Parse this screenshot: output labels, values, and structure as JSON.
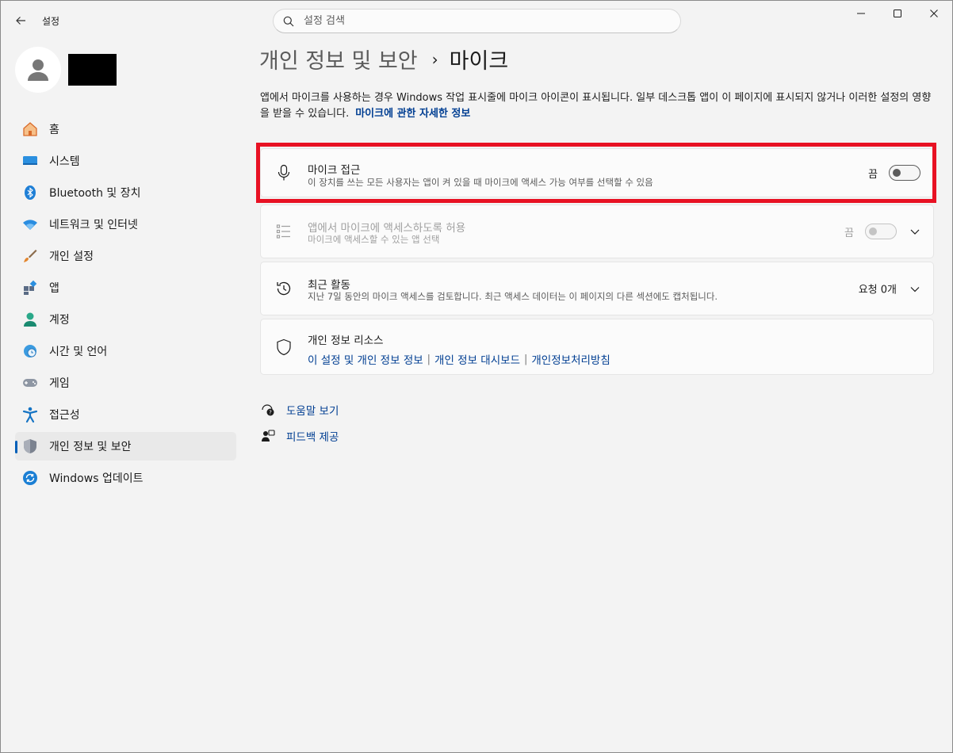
{
  "app": {
    "title": "설정",
    "search_placeholder": "설정 검색"
  },
  "nav": {
    "items": [
      {
        "label": "홈",
        "icon": "home-icon"
      },
      {
        "label": "시스템",
        "icon": "system-icon"
      },
      {
        "label": "Bluetooth 및 장치",
        "icon": "bluetooth-icon"
      },
      {
        "label": "네트워크 및 인터넷",
        "icon": "wifi-icon"
      },
      {
        "label": "개인 설정",
        "icon": "brush-icon"
      },
      {
        "label": "앱",
        "icon": "apps-icon"
      },
      {
        "label": "계정",
        "icon": "account-icon"
      },
      {
        "label": "시간 및 언어",
        "icon": "time-language-icon"
      },
      {
        "label": "게임",
        "icon": "gamepad-icon"
      },
      {
        "label": "접근성",
        "icon": "accessibility-icon"
      },
      {
        "label": "개인 정보 및 보안",
        "icon": "shield-icon"
      },
      {
        "label": "Windows 업데이트",
        "icon": "update-icon"
      }
    ],
    "active_index": 10
  },
  "header": {
    "parent": "개인 정보 및 보안",
    "separator": "›",
    "current": "마이크"
  },
  "description": {
    "text": "앱에서 마이크를 사용하는 경우 Windows 작업 표시줄에 마이크 아이콘이 표시됩니다. 일부 데스크톱 앱이 이 페이지에 표시되지 않거나 이러한 설정의 영향을 받을 수 있습니다.",
    "link": "마이크에 관한 자세한 정보"
  },
  "cards": {
    "mic_access": {
      "title": "마이크 접근",
      "subtitle": "이 장치를 쓰는 모든 사용자는 앱이 켜 있을 때 마이크에 액세스 가능 여부를 선택할 수 있음",
      "state": "끔"
    },
    "app_access": {
      "title": "앱에서 마이크에 액세스하도록 허용",
      "subtitle": "마이크에 액세스할 수 있는 앱 선택",
      "state": "끔"
    },
    "recent": {
      "title": "최근 활동",
      "subtitle": "지난 7일 동안의 마이크 액세스를 검토합니다. 최근 액세스 데이터는 이 페이지의 다른 섹션에도 캡처됩니다.",
      "value": "요청 0개"
    },
    "privacy": {
      "title": "개인 정보 리소스",
      "links": [
        "이 설정 및 개인 정보 정보",
        "개인 정보 대시보드",
        "개인정보처리방침"
      ]
    }
  },
  "footer": {
    "help": "도움말 보기",
    "feedback": "피드백 제공"
  },
  "colors": {
    "accent": "#005fb8",
    "link": "#003e92",
    "highlight": "#e81123"
  }
}
